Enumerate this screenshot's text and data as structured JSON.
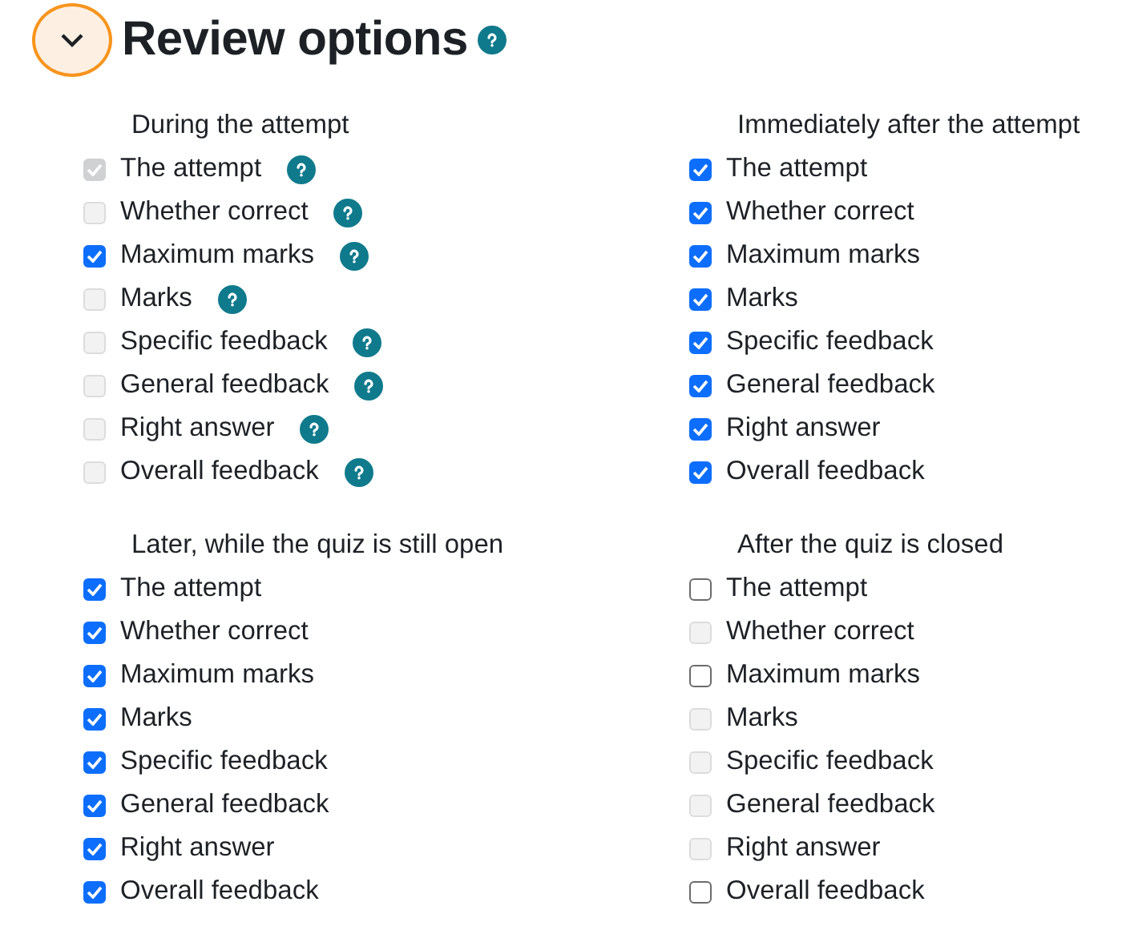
{
  "section": {
    "title": "Review options",
    "expanded": true,
    "has_help": true
  },
  "groups": [
    {
      "title": "During the attempt",
      "items": [
        {
          "label": "The attempt",
          "checked": true,
          "disabled": true,
          "has_help": true
        },
        {
          "label": "Whether correct",
          "checked": false,
          "disabled": true,
          "has_help": true
        },
        {
          "label": "Maximum marks",
          "checked": true,
          "disabled": false,
          "has_help": true
        },
        {
          "label": "Marks",
          "checked": false,
          "disabled": true,
          "has_help": true
        },
        {
          "label": "Specific feedback",
          "checked": false,
          "disabled": true,
          "has_help": true
        },
        {
          "label": "General feedback",
          "checked": false,
          "disabled": true,
          "has_help": true
        },
        {
          "label": "Right answer",
          "checked": false,
          "disabled": true,
          "has_help": true
        },
        {
          "label": "Overall feedback",
          "checked": false,
          "disabled": true,
          "has_help": true
        }
      ]
    },
    {
      "title": "Immediately after the attempt",
      "items": [
        {
          "label": "The attempt",
          "checked": true,
          "disabled": false
        },
        {
          "label": "Whether correct",
          "checked": true,
          "disabled": false
        },
        {
          "label": "Maximum marks",
          "checked": true,
          "disabled": false
        },
        {
          "label": "Marks",
          "checked": true,
          "disabled": false
        },
        {
          "label": "Specific feedback",
          "checked": true,
          "disabled": false
        },
        {
          "label": "General feedback",
          "checked": true,
          "disabled": false
        },
        {
          "label": "Right answer",
          "checked": true,
          "disabled": false
        },
        {
          "label": "Overall feedback",
          "checked": true,
          "disabled": false
        }
      ]
    },
    {
      "title": "Later, while the quiz is still open",
      "items": [
        {
          "label": "The attempt",
          "checked": true,
          "disabled": false
        },
        {
          "label": "Whether correct",
          "checked": true,
          "disabled": false
        },
        {
          "label": "Maximum marks",
          "checked": true,
          "disabled": false
        },
        {
          "label": "Marks",
          "checked": true,
          "disabled": false
        },
        {
          "label": "Specific feedback",
          "checked": true,
          "disabled": false
        },
        {
          "label": "General feedback",
          "checked": true,
          "disabled": false
        },
        {
          "label": "Right answer",
          "checked": true,
          "disabled": false
        },
        {
          "label": "Overall feedback",
          "checked": true,
          "disabled": false
        }
      ]
    },
    {
      "title": "After the quiz is closed",
      "items": [
        {
          "label": "The attempt",
          "checked": false,
          "disabled": false
        },
        {
          "label": "Whether correct",
          "checked": false,
          "disabled": true
        },
        {
          "label": "Maximum marks",
          "checked": false,
          "disabled": false
        },
        {
          "label": "Marks",
          "checked": false,
          "disabled": true
        },
        {
          "label": "Specific feedback",
          "checked": false,
          "disabled": true
        },
        {
          "label": "General feedback",
          "checked": false,
          "disabled": true
        },
        {
          "label": "Right answer",
          "checked": false,
          "disabled": true
        },
        {
          "label": "Overall feedback",
          "checked": false,
          "disabled": false
        }
      ]
    }
  ]
}
